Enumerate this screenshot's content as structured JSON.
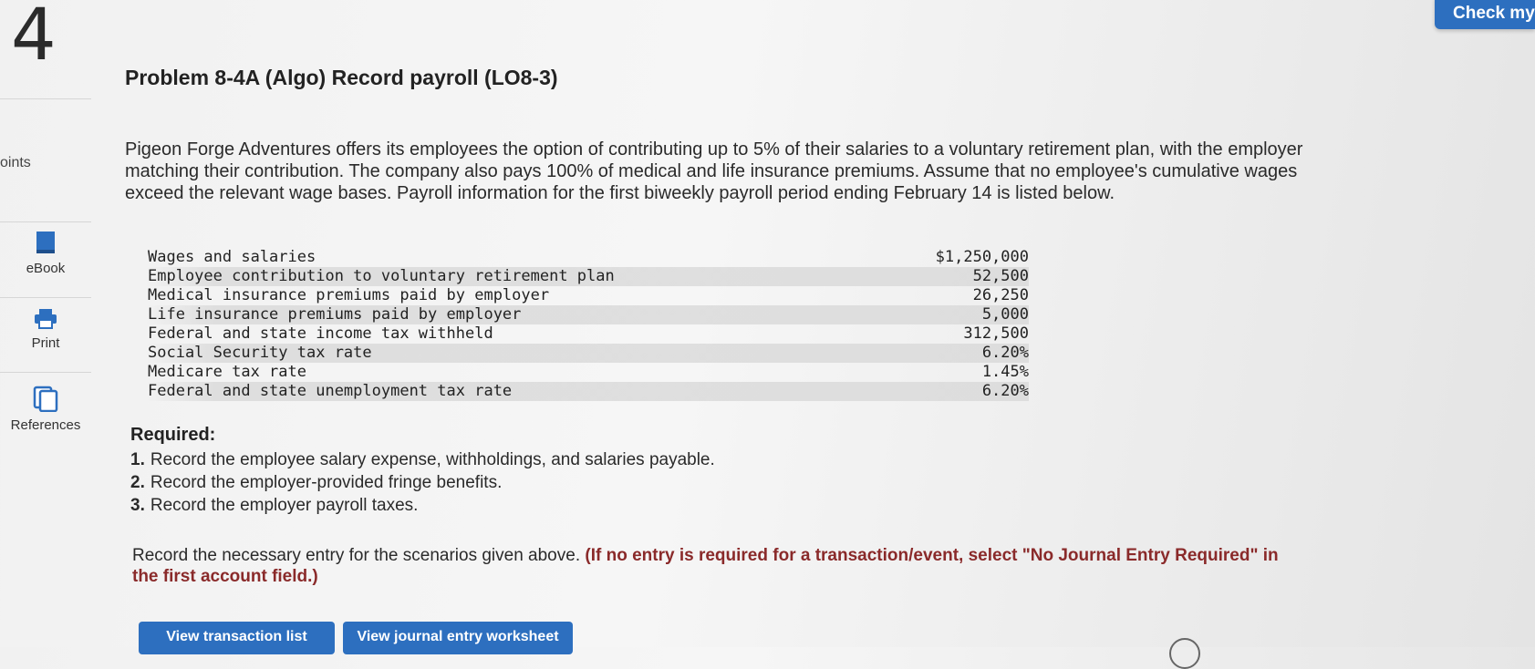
{
  "question": {
    "number": "4",
    "points_label": "oints",
    "check_button": "Check my"
  },
  "sidebar": {
    "items": [
      {
        "label": "eBook",
        "icon": "book-icon"
      },
      {
        "label": "Print",
        "icon": "printer-icon"
      },
      {
        "label": "References",
        "icon": "references-icon"
      }
    ]
  },
  "problem": {
    "title": "Problem 8-4A (Algo) Record payroll (LO8-3)",
    "description": "Pigeon Forge Adventures offers its employees the option of contributing up to 5% of their salaries to a voluntary retirement plan, with the employer matching their contribution. The company also pays 100% of medical and life insurance premiums. Assume that no employee's cumulative wages exceed the relevant wage bases. Payroll information for the first biweekly payroll period ending February 14 is listed below.",
    "payroll_items": [
      {
        "label": "Wages and salaries",
        "value": "$1,250,000"
      },
      {
        "label": "Employee contribution to voluntary retirement plan",
        "value": "52,500"
      },
      {
        "label": "Medical insurance premiums paid by employer",
        "value": "26,250"
      },
      {
        "label": "Life insurance premiums paid by employer",
        "value": "5,000"
      },
      {
        "label": "Federal and state income tax withheld",
        "value": "312,500"
      },
      {
        "label": "Social Security tax rate",
        "value": "6.20%"
      },
      {
        "label": "Medicare tax rate",
        "value": "1.45%"
      },
      {
        "label": "Federal and state unemployment tax rate",
        "value": "6.20%"
      }
    ],
    "required_label": "Required:",
    "requirements": [
      {
        "num": "1.",
        "text": "Record the employee salary expense, withholdings, and salaries payable."
      },
      {
        "num": "2.",
        "text": "Record the employer-provided fringe benefits."
      },
      {
        "num": "3.",
        "text": "Record the employer payroll taxes."
      }
    ],
    "instruction_plain": "Record the necessary entry for the scenarios given above.",
    "instruction_bold": "(If no entry is required for a transaction/event, select \"No Journal Entry Required\" in the first account field.)"
  },
  "buttons": {
    "view_transaction_list": "View transaction list",
    "view_journal_worksheet": "View journal entry worksheet"
  },
  "colors": {
    "accent": "#2d6fbf",
    "instruction_bold": "#8a2a2a"
  }
}
